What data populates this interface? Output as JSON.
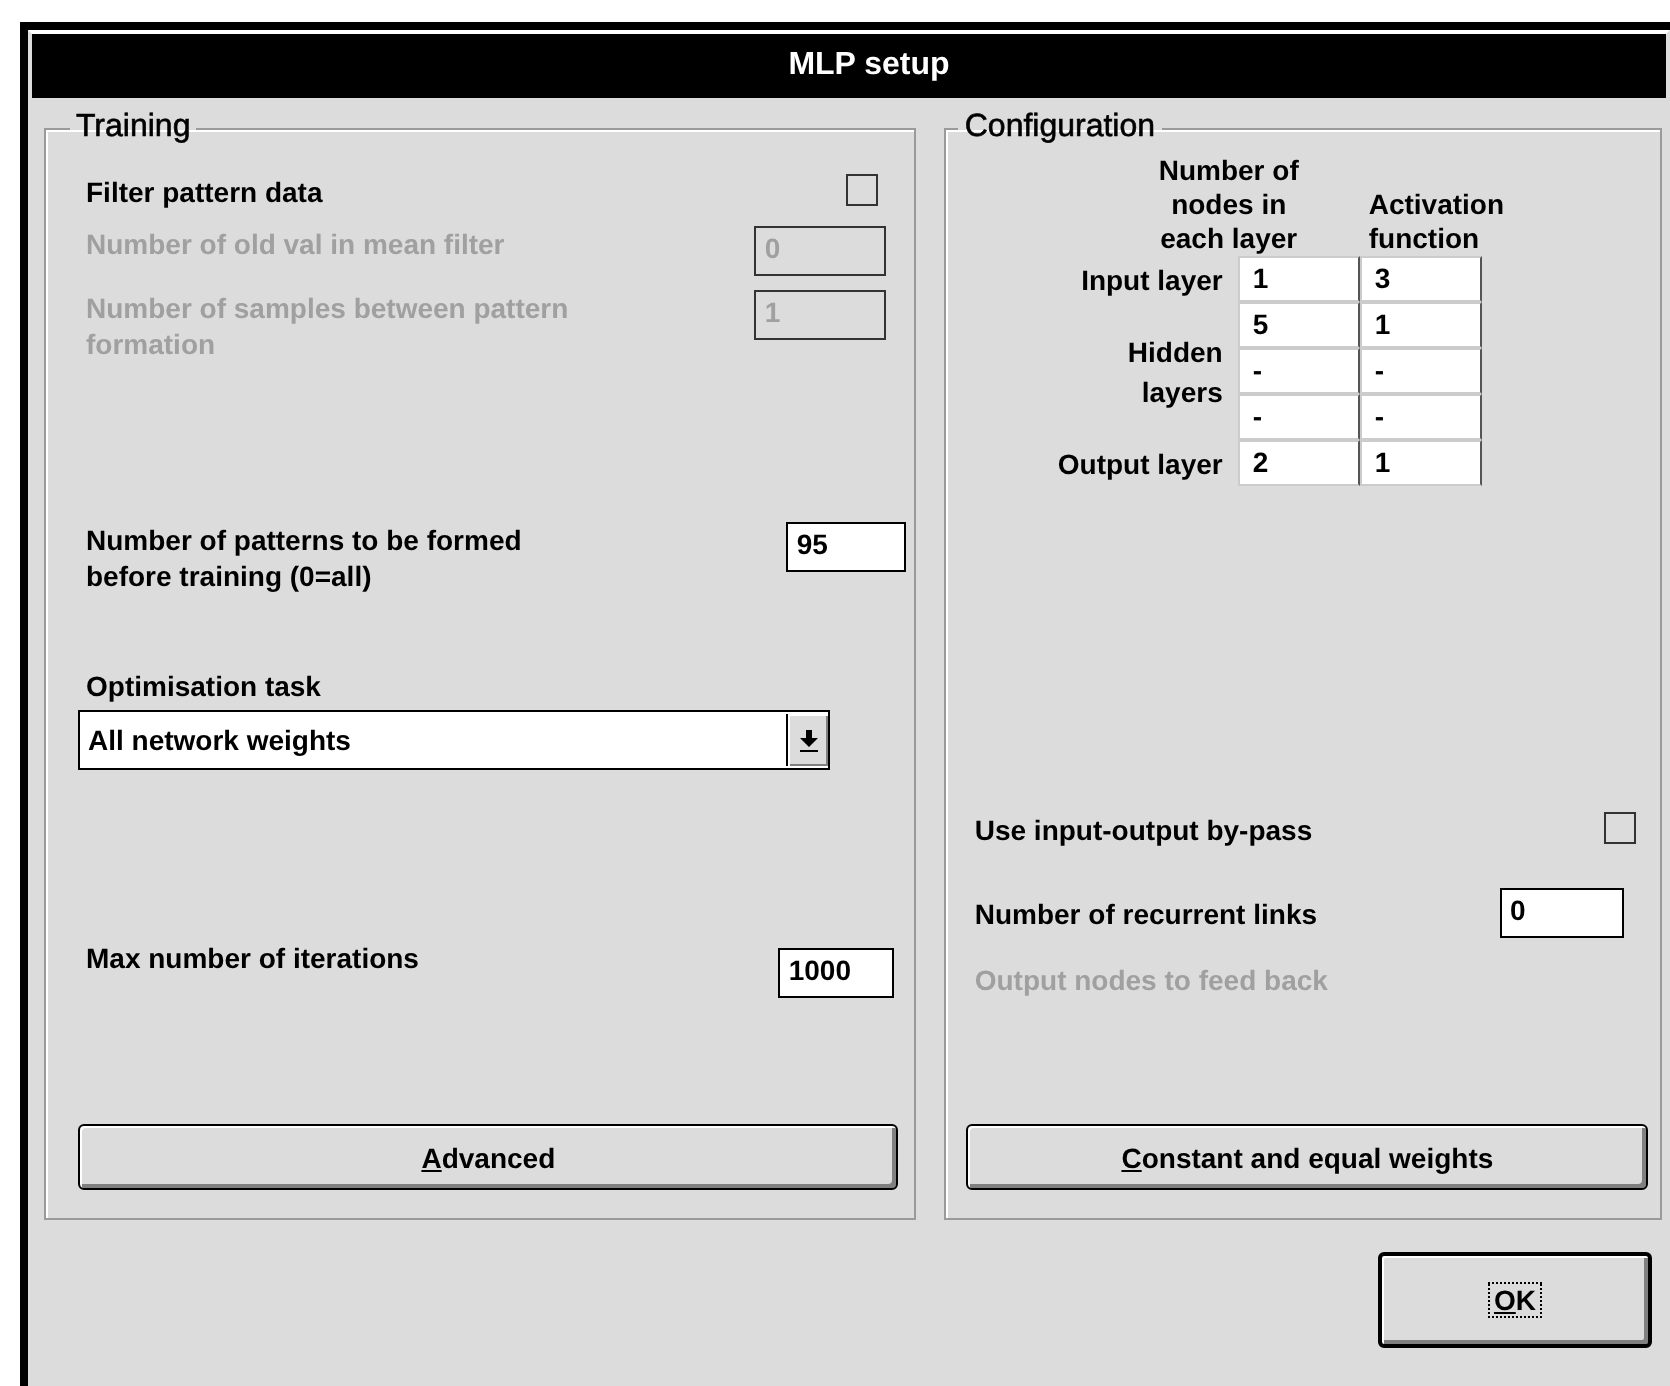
{
  "window": {
    "title": "MLP setup"
  },
  "training": {
    "title": "Training",
    "filter": {
      "label": "Filter pattern data",
      "checked": false
    },
    "mean_filter": {
      "label": "Number of old val in mean filter",
      "value": "0",
      "disabled": true
    },
    "samples_between": {
      "label": "Number of samples between pattern formation",
      "value": "1",
      "disabled": true
    },
    "patterns": {
      "label": "Number of patterns to be formed before training (0=all)",
      "value": "95",
      "disabled": false
    },
    "optimisation": {
      "label": "Optimisation task",
      "value": "All network weights"
    },
    "max_iterations": {
      "label": "Max number of iterations",
      "value": "1000"
    },
    "advanced_button": {
      "label": "Advanced"
    }
  },
  "configuration": {
    "title": "Configuration",
    "nodes_heading": "Number of nodes in each layer",
    "activation_heading": "Activation function",
    "layers": [
      {
        "label": "Input layer",
        "rows": [
          [
            "1",
            "3"
          ]
        ]
      },
      {
        "label": "Hidden layers",
        "rows": [
          [
            "5",
            "1"
          ],
          [
            "-",
            "-"
          ],
          [
            "-",
            "-"
          ]
        ]
      },
      {
        "label": "Output layer",
        "rows": [
          [
            "2",
            "1"
          ]
        ]
      }
    ],
    "bypass": {
      "label": "Use input-output by-pass",
      "checked": false
    },
    "recurrent": {
      "label": "Number of recurrent links",
      "value": "0"
    },
    "feedback": {
      "label": "Output nodes to feed back",
      "disabled": true
    },
    "constant_button": {
      "label": "Constant and equal weights"
    }
  },
  "ok_button": {
    "label": "OK",
    "focused": true
  }
}
